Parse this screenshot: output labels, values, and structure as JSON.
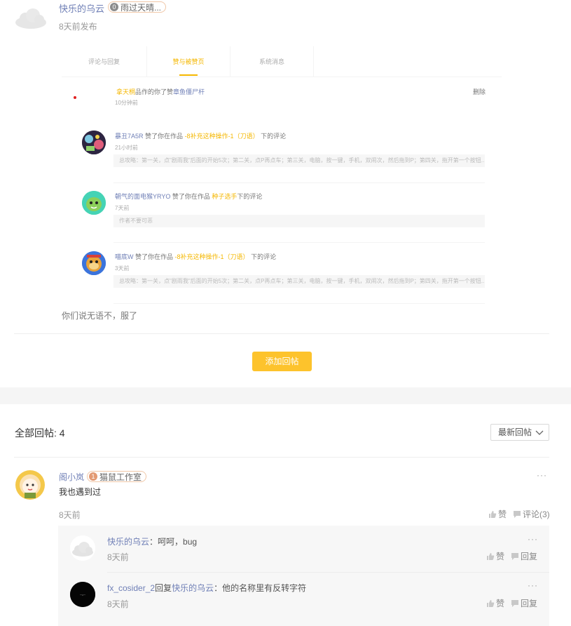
{
  "post": {
    "author": "快乐的乌云",
    "badge_level": "0",
    "badge_text": "雨过天晴...",
    "time": "8天前发布",
    "caption": "你们说无语不，服了"
  },
  "screenshot": {
    "tabs": [
      "评论与回复",
      "赞与被赞页",
      "系统消息"
    ],
    "active_tab": 1,
    "notifications": [
      {
        "user": "拿天桐",
        "text": "品作的你了赞",
        "target": "章鱼僵尸杆",
        "time": "10分钟前",
        "delete": "删除"
      },
      {
        "user": "暴丑7A5R",
        "text_before": "赞了你在作品",
        "work": "-8补充这种操作-1（刀语）",
        "text_after": "下的评论",
        "time": "21小时前",
        "quote": "总攻略：第一关，点\"剧雨我\"后面的开始5次；第二关，点P再点车；第三关，电脑，按一键，手机，双闹次，然后拖到P；第四关，拖开第一个按钮..."
      },
      {
        "user": "朝气的面电猴YRYO",
        "text_before": "赞了你在作品",
        "work": "种子选手",
        "text_after": "下的评论",
        "time": "7天前",
        "quote": "作者不要可恶"
      },
      {
        "user": "喵底W",
        "text_before": "赞了你在作品",
        "work": "-8补充这种操作-1（刀语）",
        "text_after": "下的评论",
        "time": "3天前",
        "quote": "总攻略：第一关，点\"剧雨我\"后面的开始5次；第二关，点P再点车；第三关，电脑，按一键，手机，双闹次，然后拖到P；第四关，拖开第一个按钮..."
      }
    ]
  },
  "add_reply_label": "添加回帖",
  "replies_header": {
    "label": "全部回帖: 4",
    "sort_value": "最新回帖"
  },
  "reply": {
    "author": "阁小岚",
    "badge_level": "1",
    "badge_text": "猫鼠工作室",
    "text": "我也遇到过",
    "time": "8天前",
    "like_label": "赞",
    "comment_label": "评论(3)"
  },
  "sub_replies": [
    {
      "author": "快乐的乌云",
      "text": "：呵呵，bug",
      "time": "8天前",
      "like_label": "赞",
      "reply_label": "回复"
    },
    {
      "author": "fx_cosider_2",
      "reply_word": "回复",
      "target": "快乐的乌云",
      "text": "：他的名称里有反转字符",
      "time": "8天前",
      "like_label": "赞",
      "reply_label": "回复"
    }
  ],
  "more_label": "···",
  "colors": {
    "accent": "#fdc32c",
    "link": "#6f7fb6",
    "notif_dot": "#e02020"
  }
}
